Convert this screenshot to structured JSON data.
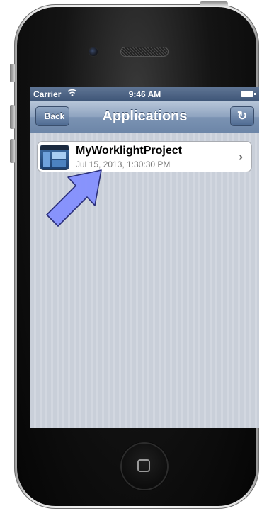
{
  "status_bar": {
    "carrier": "Carrier",
    "time": "9:46 AM",
    "wifi_icon": "wifi-icon",
    "battery_icon": "battery-icon"
  },
  "nav_bar": {
    "back_label": "Back",
    "title": "Applications",
    "refresh_icon": "refresh-icon",
    "refresh_glyph": "↻"
  },
  "applications": [
    {
      "name": "MyWorklightProject",
      "date": "Jul 15, 2013, 1:30:30 PM",
      "icon": "worklight-app-icon"
    }
  ],
  "chevron_glyph": "›",
  "colors": {
    "nav_blue": "#6d86a8",
    "annotation_arrow": "#7f8cff"
  }
}
